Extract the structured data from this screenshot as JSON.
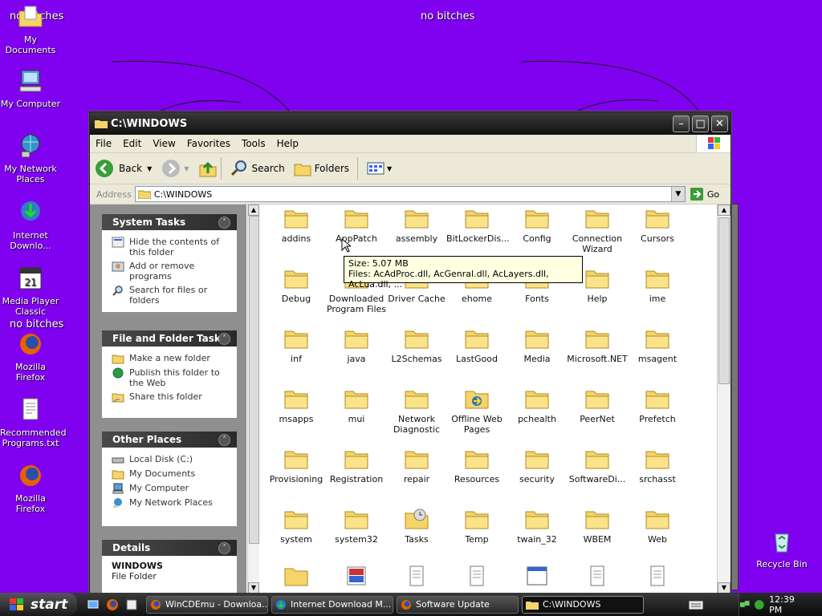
{
  "desktop": {
    "overlay_text": "no bitches",
    "icons": [
      {
        "label": "My Documents"
      },
      {
        "label": "My Computer"
      },
      {
        "label": "My Network Places"
      },
      {
        "label": "Internet Downlo..."
      },
      {
        "label": "Media Player Classic"
      },
      {
        "label": "Mozilla Firefox"
      },
      {
        "label": "Recommended Programs.txt"
      },
      {
        "label": "Mozilla Firefox"
      },
      {
        "label": "Recycle Bin"
      }
    ]
  },
  "window": {
    "title": "C:\\WINDOWS",
    "menu": [
      "File",
      "Edit",
      "View",
      "Favorites",
      "Tools",
      "Help"
    ],
    "toolbar": {
      "back": "Back",
      "search": "Search",
      "folders": "Folders"
    },
    "address": {
      "label": "Address",
      "value": "C:\\WINDOWS",
      "go": "Go"
    },
    "system_tasks": {
      "title": "System Tasks",
      "items": [
        "Hide the contents of this folder",
        "Add or remove programs",
        "Search for files or folders"
      ]
    },
    "file_tasks": {
      "title": "File and Folder Tasks",
      "items": [
        "Make a new folder",
        "Publish this folder to the Web",
        "Share this folder"
      ]
    },
    "other_places": {
      "title": "Other Places",
      "items": [
        "Local Disk (C:)",
        "My Documents",
        "My Computer",
        "My Network Places"
      ]
    },
    "details": {
      "title": "Details",
      "name": "WINDOWS",
      "type": "File Folder"
    },
    "folders": [
      "addins",
      "AppPatch",
      "assembly",
      "BitLockerDis...",
      "Config",
      "Connection Wizard",
      "Cursors",
      "Debug",
      "Downloaded Program Files",
      "Driver Cache",
      "ehome",
      "Fonts",
      "Help",
      "ime",
      "inf",
      "java",
      "L2Schemas",
      "LastGood",
      "Media",
      "Microsoft.NET",
      "msagent",
      "msapps",
      "mui",
      "Network Diagnostic",
      "Offline Web Pages",
      "pchealth",
      "PeerNet",
      "Prefetch",
      "Provisioning",
      "Registration",
      "repair",
      "Resources",
      "security",
      "SoftwareDi...",
      "srchasst",
      "system",
      "system32",
      "Tasks",
      "Temp",
      "twain_32",
      "WBEM",
      "Web"
    ],
    "tooltip": {
      "line1": "Size: 5.07 MB",
      "line2": "Files: AcAdProc.dll, AcGenral.dll, AcLayers.dll, AcLua.dll, ..."
    }
  },
  "taskbar": {
    "start": "start",
    "tasks": [
      "WinCDEmu - Downloa...",
      "Internet Download M...",
      "Software Update",
      "C:\\WINDOWS"
    ],
    "clock": "12:39 PM"
  },
  "colors": {
    "desktop": "#8000f0",
    "folder": "#f5d56a",
    "titlebar": "#1a1a1a"
  }
}
